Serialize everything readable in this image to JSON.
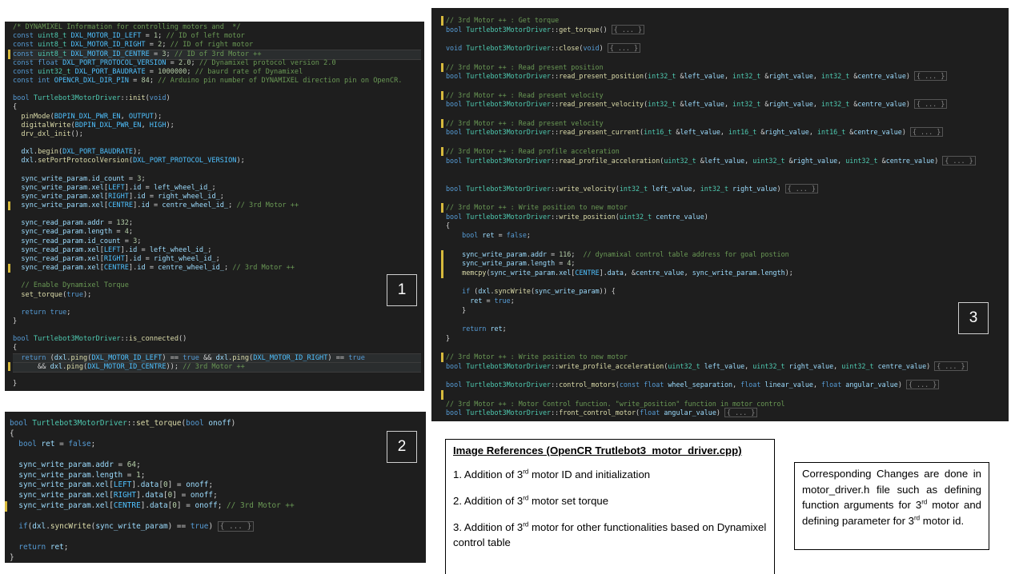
{
  "panel1": {
    "label": "1",
    "lines": [
      "/* DYNAMIXEL Information for controlling motors and  */",
      "const uint8_t DXL_MOTOR_ID_LEFT = 1; // ID of left motor",
      "const uint8_t DXL_MOTOR_ID_RIGHT = 2; // ID of right motor",
      "const uint8_t DXL_MOTOR_ID_CENTRE = 3; // ID of 3rd Motor ++",
      "const float DXL_PORT_PROTOCOL_VERSION = 2.0; // Dynamixel protocol version 2.0",
      "const uint32_t DXL_PORT_BAUDRATE = 1000000; // baurd rate of Dynamixel",
      "const int OPENCR_DXL_DIR_PIN = 84; // Arduino pin number of DYNAMIXEL direction pin on OpenCR.",
      "",
      "bool Turtlebot3MotorDriver::init(void)",
      "{",
      "  pinMode(BDPIN_DXL_PWR_EN, OUTPUT);",
      "  digitalWrite(BDPIN_DXL_PWR_EN, HIGH);",
      "  drv_dxl_init();",
      "",
      "  dxl.begin(DXL_PORT_BAUDRATE);",
      "  dxl.setPortProtocolVersion(DXL_PORT_PROTOCOL_VERSION);",
      "",
      "  sync_write_param.id_count = 3;",
      "  sync_write_param.xel[LEFT].id = left_wheel_id_;",
      "  sync_write_param.xel[RIGHT].id = right_wheel_id_;",
      "  sync_write_param.xel[CENTRE].id = centre_wheel_id_; // 3rd Motor ++",
      "",
      "  sync_read_param.addr = 132;",
      "  sync_read_param.length = 4;",
      "  sync_read_param.id_count = 3;",
      "  sync_read_param.xel[LEFT].id = left_wheel_id_;",
      "  sync_read_param.xel[RIGHT].id = right_wheel_id_;",
      "  sync_read_param.xel[CENTRE].id = centre_wheel_id_; // 3rd Motor ++",
      "",
      "  // Enable Dynamixel Torque",
      "  set_torque(true);",
      "",
      "  return true;",
      "}",
      "",
      "bool Turtlebot3MotorDriver::is_connected()",
      "{",
      "  return (dxl.ping(DXL_MOTOR_ID_LEFT) == true && dxl.ping(DXL_MOTOR_ID_RIGHT) == true",
      "      && dxl.ping(DXL_MOTOR_ID_CENTRE)); // 3rd Motor ++",
      "",
      "}"
    ]
  },
  "panel2": {
    "label": "2",
    "lines": [
      "bool Turtlebot3MotorDriver::set_torque(bool onoff)",
      "{",
      "  bool ret = false;",
      "",
      "  sync_write_param.addr = 64;",
      "  sync_write_param.length = 1;",
      "  sync_write_param.xel[LEFT].data[0] = onoff;",
      "  sync_write_param.xel[RIGHT].data[0] = onoff;",
      "  sync_write_param.xel[CENTRE].data[0] = onoff; // 3rd Motor ++",
      "",
      "  if(dxl.syncWrite(sync_write_param) == true) { ... }",
      "",
      "  return ret;",
      "}"
    ]
  },
  "panel3": {
    "label": "3",
    "lines": [
      "// 3rd Motor ++ : Get torque",
      "bool Turtlebot3MotorDriver::get_torque() { ... }",
      "",
      "void Turtlebot3MotorDriver::close(void) { ... }",
      "",
      "// 3rd Motor ++ : Read present position",
      "bool Turtlebot3MotorDriver::read_present_position(int32_t &left_value, int32_t &right_value, int32_t &centre_value) { ... }",
      "",
      "// 3rd Motor ++ : Read present velocity",
      "bool Turtlebot3MotorDriver::read_present_velocity(int32_t &left_value, int32_t &right_value, int32_t &centre_value) { ... }",
      "",
      "// 3rd Motor ++ : Read present velocity",
      "bool Turtlebot3MotorDriver::read_present_current(int16_t &left_value, int16_t &right_value, int16_t &centre_value) { ... }",
      "",
      "// 3rd Motor ++ : Read profile acceleration",
      "bool Turtlebot3MotorDriver::read_profile_acceleration(uint32_t &left_value, uint32_t &right_value, uint32_t &centre_value) { ... }",
      "",
      "",
      "bool Turtlebot3MotorDriver::write_velocity(int32_t left_value, int32_t right_value) { ... }",
      "",
      "// 3rd Motor ++ : Write position to new motor",
      "bool Turtlebot3MotorDriver::write_position(uint32_t centre_value)",
      "{",
      "    bool ret = false;",
      "",
      "    sync_write_param.addr = 116;  // dynamixal control table address for goal postion",
      "    sync_write_param.length = 4;",
      "    memcpy(sync_write_param.xel[CENTRE].data, &centre_value, sync_write_param.length);",
      "",
      "    if (dxl.syncWrite(sync_write_param)) {",
      "      ret = true;",
      "    }",
      "",
      "    return ret;",
      "}",
      "",
      "// 3rd Motor ++ : Write position to new motor",
      "bool Turtlebot3MotorDriver::write_profile_acceleration(uint32_t left_value, uint32_t right_value, uint32_t centre_value) { ... }",
      "",
      "bool Turtlebot3MotorDriver::control_motors(const float wheel_separation, float linear_value, float angular_value) { ... }",
      "",
      "// 3rd Motor ++ : Motor Control function. \"write_position\" function in motor control",
      "bool Turtlebot3MotorDriver::front_control_motor(float angular_value) { ... }"
    ]
  },
  "references": {
    "title": "Image References (OpenCR Trutlebot3_motor_driver.cpp)",
    "items": [
      {
        "pre": "1. Addition of 3",
        "sup": "rd",
        "post": " motor ID and  initialization"
      },
      {
        "pre": "2. Addition of 3",
        "sup": "rd",
        "post": " motor set torque"
      },
      {
        "pre": "3. Addition of 3",
        "sup": "rd",
        "post": " motor for other functionalities based on Dynamixel control table"
      }
    ]
  },
  "note": {
    "p1": "Corresponding Changes are done in motor_driver.h file such as defining function arguments for 3",
    "sup1": "rd",
    "p2": " motor and defining parameter for 3",
    "sup2": "rd",
    "p3": " motor id."
  },
  "colors": {
    "editor_bg": "#1e1e1e",
    "keyword": "#569cd6",
    "type": "#4ec9b0",
    "function": "#dcdcaa",
    "comment": "#6a9955",
    "number": "#b5cea8",
    "text": "#d4d4d4",
    "gutter_mark": "#d7ba3d"
  }
}
